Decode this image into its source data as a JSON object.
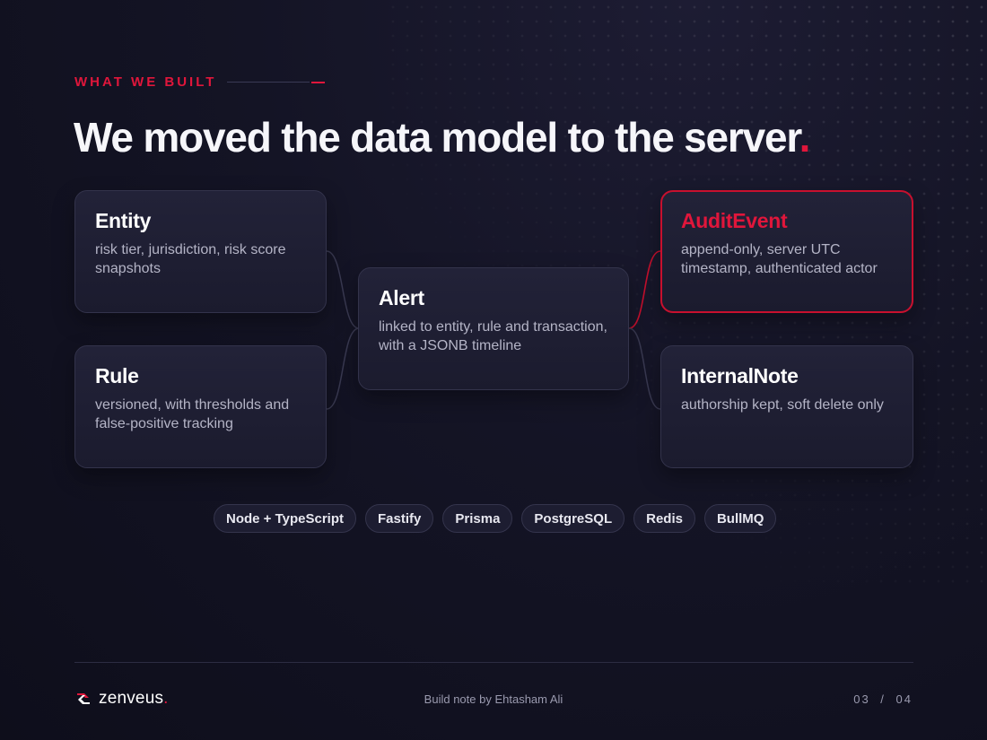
{
  "eyebrow": "WHAT WE BUILT",
  "title": {
    "main": "We moved the data model to the server",
    "dot": "."
  },
  "models": {
    "entity": {
      "name": "Entity",
      "desc": "risk tier, jurisdiction, risk score snapshots"
    },
    "rule": {
      "name": "Rule",
      "desc": "versioned, with thresholds and false-positive tracking"
    },
    "alert": {
      "name": "Alert",
      "desc": "linked to entity, rule and transaction, with a JSONB timeline"
    },
    "audit_event": {
      "name": "AuditEvent",
      "desc": "append-only, server UTC timestamp, authenticated actor",
      "highlight": true
    },
    "internal_note": {
      "name": "InternalNote",
      "desc": "authorship kept, soft delete only"
    }
  },
  "links": [
    {
      "from": "Entity",
      "to": "Alert"
    },
    {
      "from": "Rule",
      "to": "Alert"
    },
    {
      "from": "Alert",
      "to": "AuditEvent",
      "highlight": true
    },
    {
      "from": "Alert",
      "to": "InternalNote"
    }
  ],
  "stack": [
    "Node + TypeScript",
    "Fastify",
    "Prisma",
    "PostgreSQL",
    "Redis",
    "BullMQ"
  ],
  "footer": {
    "brand": "zenveus",
    "brand_dot": ".",
    "byline": "Build note by Ehtasham Ali",
    "page": "03  /  04"
  },
  "colors": {
    "accent": "#e0163b",
    "background": "#12121f",
    "card": "#1e1e33"
  }
}
